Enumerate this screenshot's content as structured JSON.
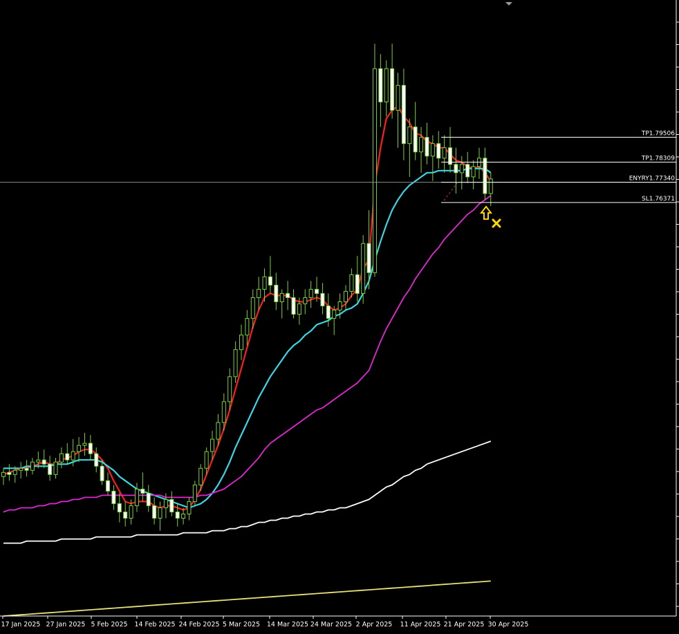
{
  "chart_data": {
    "type": "candlestick",
    "x_tick_labels": [
      "17 Jan 2025",
      "27 Jan 2025",
      "5 Feb 2025",
      "14 Feb 2025",
      "24 Feb 2025",
      "5 Mar 2025",
      "14 Mar 2025",
      "24 Mar 2025",
      "2 Apr 2025",
      "11 Apr 2025",
      "21 Apr 2025",
      "30 Apr 2025"
    ],
    "y_range": [
      1.565,
      1.86
    ],
    "candles": [
      [
        1.632,
        1.636,
        1.628,
        1.634
      ],
      [
        1.634,
        1.638,
        1.63,
        1.633
      ],
      [
        1.633,
        1.637,
        1.629,
        1.635
      ],
      [
        1.635,
        1.639,
        1.631,
        1.636
      ],
      [
        1.636,
        1.64,
        1.632,
        1.635
      ],
      [
        1.635,
        1.641,
        1.633,
        1.639
      ],
      [
        1.639,
        1.644,
        1.636,
        1.64
      ],
      [
        1.64,
        1.645,
        1.636,
        1.638
      ],
      [
        1.638,
        1.642,
        1.63,
        1.633
      ],
      [
        1.633,
        1.641,
        1.631,
        1.639
      ],
      [
        1.639,
        1.646,
        1.636,
        1.643
      ],
      [
        1.643,
        1.648,
        1.638,
        1.64
      ],
      [
        1.64,
        1.65,
        1.637,
        1.644
      ],
      [
        1.644,
        1.651,
        1.639,
        1.647
      ],
      [
        1.647,
        1.653,
        1.642,
        1.648
      ],
      [
        1.648,
        1.652,
        1.64,
        1.643
      ],
      [
        1.643,
        1.646,
        1.634,
        1.637
      ],
      [
        1.637,
        1.64,
        1.628,
        1.63
      ],
      [
        1.63,
        1.634,
        1.623,
        1.625
      ],
      [
        1.625,
        1.628,
        1.616,
        1.619
      ],
      [
        1.619,
        1.624,
        1.61,
        1.615
      ],
      [
        1.615,
        1.62,
        1.608,
        1.612
      ],
      [
        1.612,
        1.621,
        1.609,
        1.618
      ],
      [
        1.618,
        1.629,
        1.615,
        1.626
      ],
      [
        1.626,
        1.634,
        1.62,
        1.624
      ],
      [
        1.624,
        1.628,
        1.615,
        1.618
      ],
      [
        1.618,
        1.622,
        1.609,
        1.612
      ],
      [
        1.612,
        1.62,
        1.606,
        1.617
      ],
      [
        1.617,
        1.624,
        1.612,
        1.621
      ],
      [
        1.621,
        1.625,
        1.613,
        1.615
      ],
      [
        1.615,
        1.619,
        1.608,
        1.612
      ],
      [
        1.612,
        1.617,
        1.609,
        1.614
      ],
      [
        1.614,
        1.622,
        1.611,
        1.62
      ],
      [
        1.62,
        1.63,
        1.618,
        1.628
      ],
      [
        1.628,
        1.638,
        1.625,
        1.636
      ],
      [
        1.636,
        1.646,
        1.633,
        1.644
      ],
      [
        1.644,
        1.654,
        1.64,
        1.65
      ],
      [
        1.65,
        1.662,
        1.647,
        1.658
      ],
      [
        1.658,
        1.672,
        1.654,
        1.668
      ],
      [
        1.668,
        1.684,
        1.664,
        1.68
      ],
      [
        1.68,
        1.697,
        1.677,
        1.693
      ],
      [
        1.693,
        1.705,
        1.688,
        1.7
      ],
      [
        1.7,
        1.712,
        1.695,
        1.708
      ],
      [
        1.708,
        1.722,
        1.703,
        1.718
      ],
      [
        1.718,
        1.728,
        1.712,
        1.722
      ],
      [
        1.722,
        1.732,
        1.716,
        1.728
      ],
      [
        1.728,
        1.738,
        1.72,
        1.724
      ],
      [
        1.724,
        1.73,
        1.712,
        1.716
      ],
      [
        1.716,
        1.722,
        1.708,
        1.72
      ],
      [
        1.72,
        1.726,
        1.712,
        1.718
      ],
      [
        1.718,
        1.722,
        1.708,
        1.71
      ],
      [
        1.71,
        1.718,
        1.705,
        1.715
      ],
      [
        1.715,
        1.722,
        1.71,
        1.718
      ],
      [
        1.718,
        1.726,
        1.713,
        1.722
      ],
      [
        1.722,
        1.728,
        1.716,
        1.72
      ],
      [
        1.72,
        1.725,
        1.71,
        1.714
      ],
      [
        1.714,
        1.72,
        1.704,
        1.708
      ],
      [
        1.708,
        1.714,
        1.7,
        1.712
      ],
      [
        1.712,
        1.72,
        1.708,
        1.716
      ],
      [
        1.716,
        1.724,
        1.712,
        1.721
      ],
      [
        1.721,
        1.732,
        1.718,
        1.729
      ],
      [
        1.729,
        1.738,
        1.716,
        1.72
      ],
      [
        1.72,
        1.748,
        1.715,
        1.744
      ],
      [
        1.744,
        1.76,
        1.722,
        1.73
      ],
      [
        1.73,
        1.84,
        1.728,
        1.828
      ],
      [
        1.828,
        1.835,
        1.8,
        1.812
      ],
      [
        1.812,
        1.832,
        1.805,
        1.828
      ],
      [
        1.828,
        1.84,
        1.804,
        1.808
      ],
      [
        1.808,
        1.826,
        1.79,
        1.82
      ],
      [
        1.82,
        1.828,
        1.784,
        1.792
      ],
      [
        1.792,
        1.804,
        1.776,
        1.8
      ],
      [
        1.8,
        1.812,
        1.784,
        1.788
      ],
      [
        1.788,
        1.8,
        1.778,
        1.795
      ],
      [
        1.795,
        1.802,
        1.782,
        1.786
      ],
      [
        1.786,
        1.796,
        1.774,
        1.792
      ],
      [
        1.792,
        1.798,
        1.78,
        1.785
      ],
      [
        1.785,
        1.796,
        1.778,
        1.79
      ],
      [
        1.79,
        1.8,
        1.778,
        1.782
      ],
      [
        1.782,
        1.79,
        1.768,
        1.778
      ],
      [
        1.778,
        1.786,
        1.77,
        1.782
      ],
      [
        1.782,
        1.788,
        1.773,
        1.776
      ],
      [
        1.776,
        1.784,
        1.77,
        1.781
      ],
      [
        1.781,
        1.79,
        1.775,
        1.785
      ],
      [
        1.785,
        1.79,
        1.765,
        1.768
      ],
      [
        1.768,
        1.778,
        1.762,
        1.775
      ]
    ],
    "series": [
      {
        "color": "#ff1e1e",
        "values": [
          1.633,
          1.634,
          1.635,
          1.636,
          1.636,
          1.637,
          1.638,
          1.639,
          1.638,
          1.638,
          1.64,
          1.641,
          1.642,
          1.644,
          1.645,
          1.645,
          1.643,
          1.64,
          1.636,
          1.63,
          1.625,
          1.62,
          1.619,
          1.62,
          1.62,
          1.62,
          1.618,
          1.617,
          1.618,
          1.618,
          1.617,
          1.616,
          1.617,
          1.621,
          1.626,
          1.633,
          1.64,
          1.647,
          1.655,
          1.664,
          1.674,
          1.684,
          1.694,
          1.704,
          1.712,
          1.718,
          1.72,
          1.719,
          1.719,
          1.719,
          1.717,
          1.716,
          1.716,
          1.717,
          1.718,
          1.717,
          1.714,
          1.712,
          1.713,
          1.715,
          1.719,
          1.722,
          1.732,
          1.736,
          1.772,
          1.79,
          1.804,
          1.808,
          1.81,
          1.805,
          1.802,
          1.797,
          1.796,
          1.793,
          1.792,
          1.79,
          1.79,
          1.787,
          1.784,
          1.783,
          1.781,
          1.78,
          1.781,
          1.778,
          1.774
        ]
      },
      {
        "color": "#3ad7e6",
        "values": [
          1.636,
          1.636,
          1.636,
          1.636,
          1.637,
          1.637,
          1.637,
          1.637,
          1.637,
          1.638,
          1.638,
          1.638,
          1.639,
          1.64,
          1.64,
          1.64,
          1.64,
          1.639,
          1.637,
          1.635,
          1.632,
          1.63,
          1.628,
          1.626,
          1.625,
          1.624,
          1.623,
          1.622,
          1.621,
          1.62,
          1.619,
          1.618,
          1.617,
          1.618,
          1.619,
          1.621,
          1.624,
          1.628,
          1.633,
          1.639,
          1.646,
          1.652,
          1.658,
          1.664,
          1.67,
          1.675,
          1.68,
          1.684,
          1.688,
          1.692,
          1.695,
          1.697,
          1.7,
          1.702,
          1.705,
          1.706,
          1.707,
          1.709,
          1.71,
          1.712,
          1.713,
          1.715,
          1.72,
          1.726,
          1.736,
          1.745,
          1.753,
          1.76,
          1.765,
          1.769,
          1.772,
          1.774,
          1.776,
          1.778,
          1.778,
          1.779,
          1.779,
          1.779,
          1.779,
          1.779,
          1.78,
          1.78,
          1.78,
          1.78,
          1.778
        ]
      },
      {
        "color": "#e228d2",
        "values": [
          1.615,
          1.616,
          1.616,
          1.617,
          1.617,
          1.617,
          1.618,
          1.618,
          1.619,
          1.619,
          1.62,
          1.62,
          1.621,
          1.621,
          1.622,
          1.622,
          1.622,
          1.623,
          1.623,
          1.623,
          1.623,
          1.623,
          1.623,
          1.623,
          1.623,
          1.623,
          1.623,
          1.623,
          1.622,
          1.622,
          1.622,
          1.622,
          1.622,
          1.622,
          1.623,
          1.623,
          1.624,
          1.625,
          1.626,
          1.628,
          1.63,
          1.632,
          1.635,
          1.638,
          1.641,
          1.645,
          1.648,
          1.65,
          1.652,
          1.654,
          1.656,
          1.658,
          1.66,
          1.662,
          1.664,
          1.665,
          1.667,
          1.669,
          1.671,
          1.673,
          1.675,
          1.677,
          1.68,
          1.683,
          1.69,
          1.697,
          1.703,
          1.708,
          1.713,
          1.718,
          1.722,
          1.727,
          1.731,
          1.735,
          1.739,
          1.742,
          1.746,
          1.749,
          1.752,
          1.755,
          1.758,
          1.76,
          1.763,
          1.765,
          1.767
        ]
      },
      {
        "color": "#ffffff",
        "values": [
          1.6,
          1.6,
          1.6,
          1.6,
          1.601,
          1.601,
          1.601,
          1.601,
          1.601,
          1.601,
          1.602,
          1.602,
          1.602,
          1.602,
          1.602,
          1.602,
          1.603,
          1.603,
          1.603,
          1.603,
          1.603,
          1.603,
          1.603,
          1.604,
          1.604,
          1.604,
          1.604,
          1.604,
          1.604,
          1.604,
          1.604,
          1.605,
          1.605,
          1.605,
          1.605,
          1.605,
          1.606,
          1.606,
          1.606,
          1.607,
          1.607,
          1.608,
          1.608,
          1.609,
          1.61,
          1.61,
          1.611,
          1.611,
          1.612,
          1.612,
          1.613,
          1.613,
          1.614,
          1.614,
          1.615,
          1.615,
          1.616,
          1.616,
          1.617,
          1.617,
          1.618,
          1.619,
          1.62,
          1.621,
          1.623,
          1.625,
          1.627,
          1.628,
          1.63,
          1.632,
          1.633,
          1.635,
          1.636,
          1.638,
          1.639,
          1.64,
          1.641,
          1.642,
          1.643,
          1.644,
          1.645,
          1.646,
          1.647,
          1.648,
          1.649
        ]
      },
      {
        "color": "#e8e07a",
        "values": [
          1.565,
          1.5652,
          1.5654,
          1.5656,
          1.5658,
          1.566,
          1.5662,
          1.5664,
          1.5666,
          1.5668,
          1.567,
          1.5672,
          1.5674,
          1.5676,
          1.5678,
          1.568,
          1.5682,
          1.5684,
          1.5686,
          1.5688,
          1.569,
          1.5692,
          1.5694,
          1.5696,
          1.5698,
          1.57,
          1.5702,
          1.5704,
          1.5706,
          1.5708,
          1.571,
          1.5712,
          1.5714,
          1.5716,
          1.5718,
          1.572,
          1.5722,
          1.5724,
          1.5726,
          1.5728,
          1.573,
          1.5732,
          1.5734,
          1.5736,
          1.5738,
          1.574,
          1.5742,
          1.5744,
          1.5746,
          1.5748,
          1.575,
          1.5752,
          1.5754,
          1.5756,
          1.5758,
          1.576,
          1.5762,
          1.5764,
          1.5766,
          1.5768,
          1.577,
          1.5772,
          1.5774,
          1.5776,
          1.5778,
          1.578,
          1.5782,
          1.5784,
          1.5786,
          1.5788,
          1.579,
          1.5792,
          1.5794,
          1.5796,
          1.5798,
          1.58,
          1.5802,
          1.5804,
          1.5806,
          1.5808,
          1.581,
          1.5812,
          1.5814,
          1.5816,
          1.5818
        ]
      }
    ],
    "levels": [
      {
        "label": "TP1.79506",
        "value": 1.79506
      },
      {
        "label": "TP1.78309",
        "value": 1.78309
      },
      {
        "label": "ENYRY1.77340",
        "value": 1.7734
      },
      {
        "label": "SL1.76371",
        "value": 1.76371
      }
    ],
    "current_price": 1.7734,
    "entry_arrow": {
      "direction": "up",
      "color": "#ffd700"
    },
    "exit_marker": {
      "symbol": "x",
      "color": "#ffd700"
    },
    "colors": {
      "background": "#000000",
      "candle": "#7cd13c",
      "candle_body_bull": "#000000",
      "candle_body_bear": "#ffffff",
      "axis": "#ffffff",
      "level_line": "#ffffff"
    }
  }
}
